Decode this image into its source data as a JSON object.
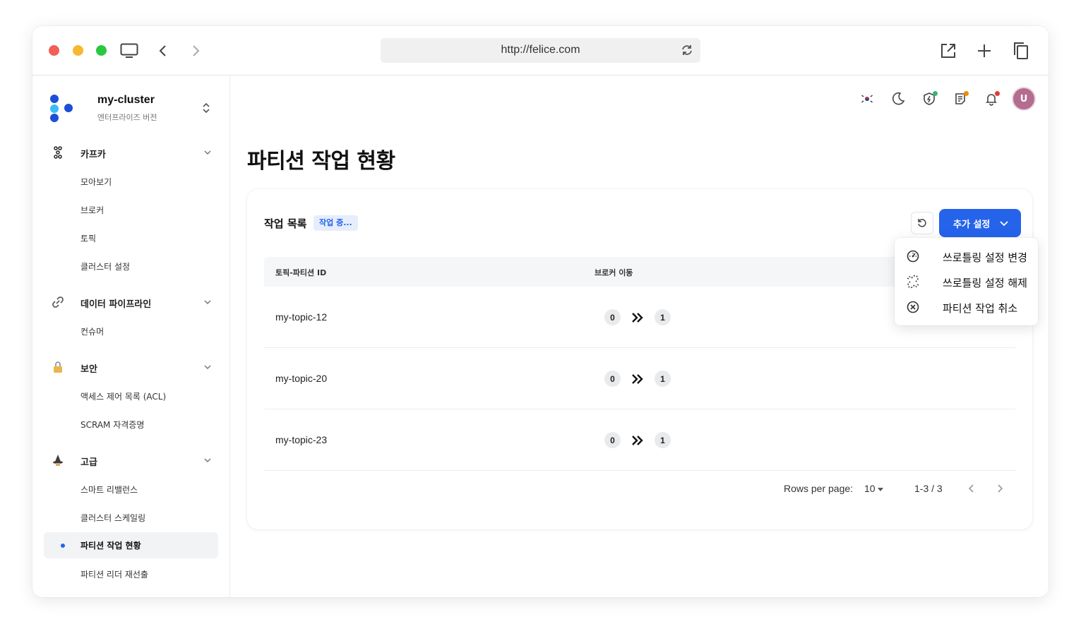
{
  "browser": {
    "url": "http://felice.com"
  },
  "cluster": {
    "name": "my-cluster",
    "edition": "엔터프라이즈 버전"
  },
  "sidebar": {
    "groups": [
      {
        "label": "카프카",
        "items": [
          "모아보기",
          "브로커",
          "토픽",
          "클러스터 설정"
        ]
      },
      {
        "label": "데이터 파이프라인",
        "items": [
          "컨슈머"
        ]
      },
      {
        "label": "보안",
        "items": [
          "액세스 제어 목록 (ACL)",
          "SCRAM 자격증명"
        ]
      },
      {
        "label": "고급",
        "items": [
          "스마트 리밸런스",
          "클러스터 스케일링",
          "파티션 작업 현황",
          "파티션 리더 재선출"
        ]
      }
    ],
    "active_item": "파티션 작업 현황"
  },
  "header": {
    "avatar_initial": "U",
    "badge_colors": {
      "shield": "#3cb371",
      "notes": "#f08c00",
      "bell": "#e53935"
    }
  },
  "page": {
    "title": "파티션 작업 현황"
  },
  "card": {
    "title": "작업 목록",
    "status": "작업 중...",
    "action_button": "추가 설정",
    "columns": [
      "토픽-파티션 ID",
      "브로커 이동"
    ],
    "rows": [
      {
        "topic": "my-topic-12",
        "from": "0",
        "to": "1"
      },
      {
        "topic": "my-topic-20",
        "from": "0",
        "to": "1"
      },
      {
        "topic": "my-topic-23",
        "from": "0",
        "to": "1"
      }
    ],
    "pagination": {
      "rows_label": "Rows per page:",
      "rows_value": "10",
      "range": "1-3 / 3"
    }
  },
  "dropdown": {
    "items": [
      {
        "label": "쓰로틀링 설정 변경",
        "icon": "gauge-icon"
      },
      {
        "label": "쓰로틀링 설정 해제",
        "icon": "unlink-icon"
      },
      {
        "label": "파티션 작업 취소",
        "icon": "cancel-circle-icon"
      }
    ]
  },
  "colors": {
    "primary": "#2563eb",
    "status_chip_bg": "#e6eefc"
  }
}
